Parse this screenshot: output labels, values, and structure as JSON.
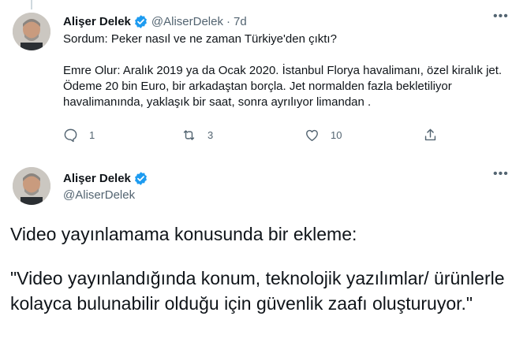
{
  "tweet1": {
    "display_name": "Alişer Delek",
    "handle": "@AliserDelek",
    "separator": "·",
    "time": "7d",
    "more_label": "•••",
    "question": "Sordum: Peker nasıl ve ne zaman Türkiye'den çıktı?",
    "answer": "Emre Olur: Aralık 2019 ya da Ocak 2020. İstanbul Florya havalimanı, özel kiralık jet. Ödeme 20 bin Euro, bir arkadaştan borçla. Jet normalden fazla bekletiliyor havalimanında, yaklaşık bir saat, sonra ayrılıyor limandan .",
    "actions": {
      "reply_count": "1",
      "retweet_count": "3",
      "like_count": "10",
      "reply_icon": "reply-icon",
      "retweet_icon": "retweet-icon",
      "like_icon": "heart-icon",
      "share_icon": "share-icon"
    }
  },
  "tweet2": {
    "display_name": "Alişer Delek",
    "handle": "@AliserDelek",
    "more_label": "•••",
    "line1": "Video yayınlamama konusunda bir ekleme:",
    "line2": "\"Video yayınlandığında konum, teknolojik yazılımlar/ ürünlerle kolayca bulunabilir olduğu için güvenlik zaafı oluşturuyor.\""
  },
  "colors": {
    "text": "#0f1419",
    "secondary": "#536471",
    "verified": "#1d9bf0",
    "thread_line": "#cfd9de"
  }
}
